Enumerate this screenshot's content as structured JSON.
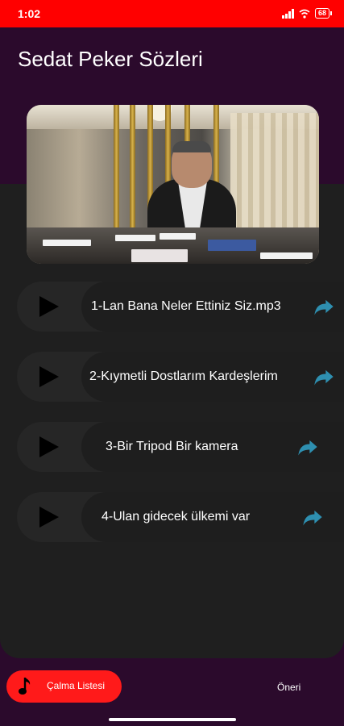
{
  "status_bar": {
    "time": "1:02",
    "battery": "68"
  },
  "app": {
    "title": "Sedat Peker Sözleri"
  },
  "tracks": [
    {
      "title": "1-Lan Bana Neler Ettiniz Siz.mp3"
    },
    {
      "title": "2-Kıymetli Dostlarım Kardeşlerim"
    },
    {
      "title": "3-Bir Tripod Bir kamera"
    },
    {
      "title": "4-Ulan gidecek ülkemi var"
    }
  ],
  "bottom_nav": {
    "playlist_label": "Çalma Listesi",
    "suggest_label": "Öneri"
  },
  "colors": {
    "status_bar": "#ff0000",
    "app_background": "#2b0a2c",
    "panel": "#1f1f1f",
    "accent_share": "#2e8fb0",
    "playlist_button": "#ff1a1a"
  },
  "icons": [
    "play-icon",
    "share-icon",
    "music-note-icon",
    "wifi-icon",
    "signal-icon",
    "battery-icon"
  ]
}
